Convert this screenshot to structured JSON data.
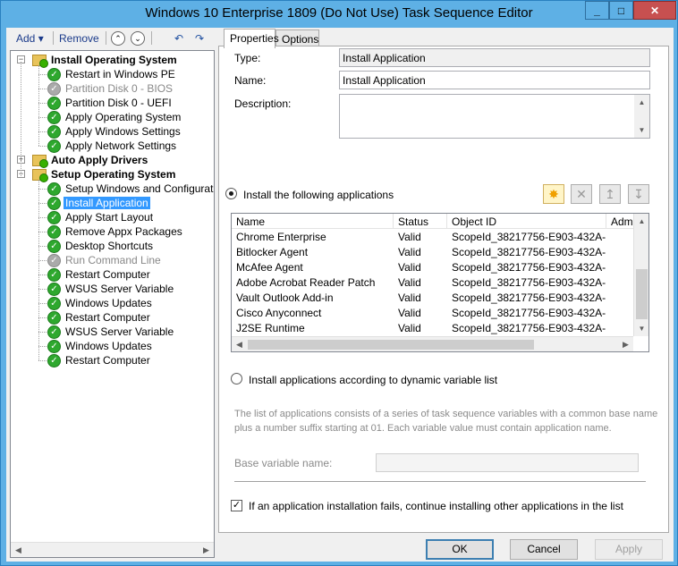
{
  "window": {
    "title": "Windows 10 Enterprise 1809 (Do Not Use) Task Sequence Editor",
    "minimize": "_",
    "maximize": "□",
    "close": "✕"
  },
  "toolbar": {
    "add_label": "Add",
    "add_arrow": "▾",
    "remove_label": "Remove"
  },
  "tree": {
    "nodes": [
      {
        "label": "Install Operating System",
        "type": "group",
        "expander": "−"
      },
      {
        "label": "Restart in Windows PE",
        "type": "step"
      },
      {
        "label": "Partition Disk 0 - BIOS",
        "type": "step-disabled"
      },
      {
        "label": "Partition Disk 0 - UEFI",
        "type": "step"
      },
      {
        "label": "Apply Operating System",
        "type": "step"
      },
      {
        "label": "Apply Windows Settings",
        "type": "step"
      },
      {
        "label": "Apply Network Settings",
        "type": "step"
      },
      {
        "label": "Auto Apply Drivers",
        "type": "group",
        "expander": "+"
      },
      {
        "label": "Setup Operating System",
        "type": "group",
        "expander": "−"
      },
      {
        "label": "Setup Windows and Configuration",
        "type": "step"
      },
      {
        "label": "Install Application",
        "type": "step-selected"
      },
      {
        "label": "Apply Start Layout",
        "type": "step"
      },
      {
        "label": "Remove Appx Packages",
        "type": "step"
      },
      {
        "label": "Desktop Shortcuts",
        "type": "step"
      },
      {
        "label": "Run Command Line",
        "type": "step-disabled"
      },
      {
        "label": "Restart Computer",
        "type": "step"
      },
      {
        "label": "WSUS Server Variable",
        "type": "step"
      },
      {
        "label": "Windows Updates",
        "type": "step"
      },
      {
        "label": "Restart Computer",
        "type": "step"
      },
      {
        "label": "WSUS Server Variable",
        "type": "step"
      },
      {
        "label": "Windows Updates",
        "type": "step"
      },
      {
        "label": "Restart Computer",
        "type": "step"
      }
    ]
  },
  "tabs": [
    {
      "label": "Properties",
      "active": true
    },
    {
      "label": "Options",
      "active": false
    }
  ],
  "properties": {
    "type_label": "Type:",
    "type_value": "Install Application",
    "name_label": "Name:",
    "name_value": "Install Application",
    "description_label": "Description:",
    "description_value": "",
    "radio_install_following": "Install the following applications",
    "radio_dynamic": "Install applications according to dynamic variable list",
    "dynamic_info": "The list of applications consists of a series of task sequence variables with a common base name plus a number suffix starting at 01. Each variable value must contain application name.",
    "base_variable_label": "Base variable name:",
    "base_variable_value": "",
    "continue_checkbox": "If an application installation fails, continue installing other applications in the list"
  },
  "app_grid": {
    "columns": [
      "Name",
      "Status",
      "Object ID",
      "Admi"
    ],
    "rows": [
      [
        "Chrome Enterprise",
        "Valid",
        "ScopeId_38217756-E903-432A-..."
      ],
      [
        "Bitlocker Agent",
        "Valid",
        "ScopeId_38217756-E903-432A-..."
      ],
      [
        "McAfee Agent",
        "Valid",
        "ScopeId_38217756-E903-432A-..."
      ],
      [
        "Adobe Acrobat Reader Patch",
        "Valid",
        "ScopeId_38217756-E903-432A-..."
      ],
      [
        "Vault Outlook Add-in",
        "Valid",
        "ScopeId_38217756-E903-432A-..."
      ],
      [
        "Cisco Anyconnect",
        "Valid",
        "ScopeId_38217756-E903-432A-..."
      ],
      [
        "J2SE Runtime",
        "Valid",
        "ScopeId_38217756-E903-432A-..."
      ]
    ]
  },
  "buttons": {
    "ok": "OK",
    "cancel": "Cancel",
    "apply": "Apply"
  }
}
